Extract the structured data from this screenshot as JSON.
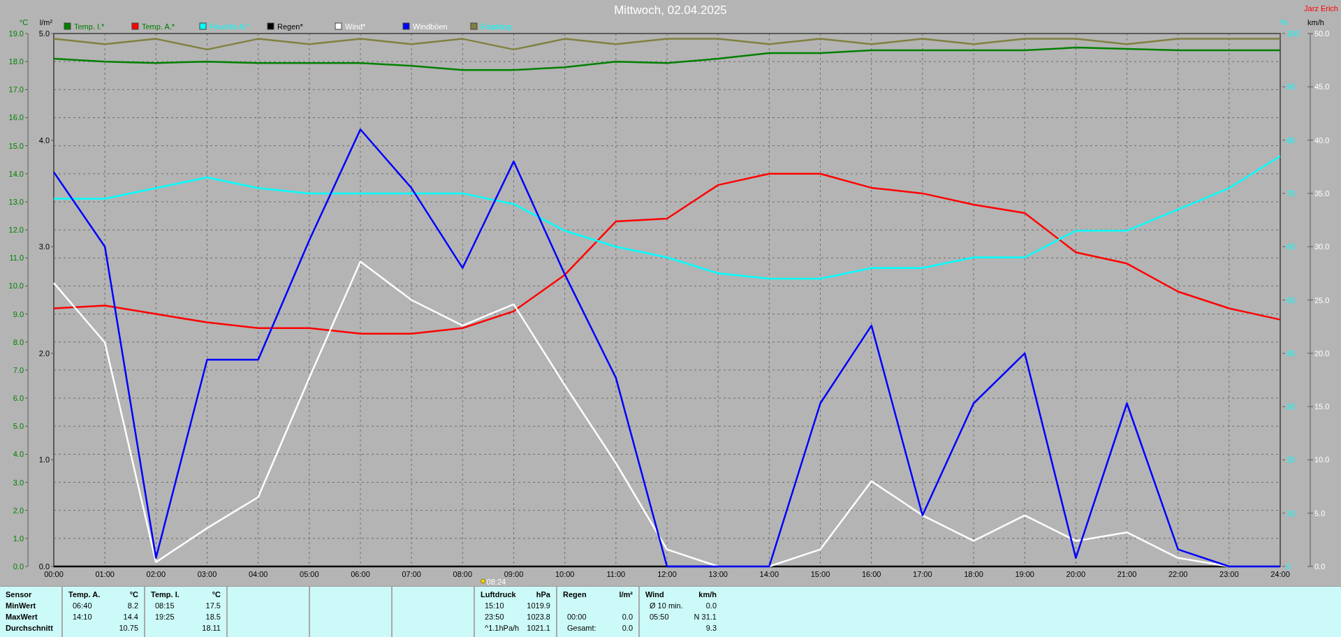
{
  "title": "Mittwoch, 02.04.2025",
  "author": "Jarz Erich",
  "chart": {
    "chart_data": {
      "type": "line",
      "categories": [
        "00:00",
        "01:00",
        "02:00",
        "03:00",
        "04:00",
        "05:00",
        "06:00",
        "07:00",
        "08:00",
        "09:00",
        "10:00",
        "11:00",
        "12:00",
        "13:00",
        "14:00",
        "15:00",
        "16:00",
        "17:00",
        "18:00",
        "19:00",
        "20:00",
        "21:00",
        "22:00",
        "23:00",
        "24:00"
      ],
      "grid": true,
      "legend": "top",
      "ylim": [
        0,
        19
      ],
      "y2lim": [
        0,
        100
      ],
      "y3lim": [
        0,
        50
      ],
      "y2ticks": [
        {
          "value": 0,
          "label": "0"
        },
        {
          "value": 10,
          "label": "10"
        },
        {
          "value": 20,
          "label": "20"
        },
        {
          "value": 30,
          "label": "30"
        },
        {
          "value": 40,
          "label": "40"
        },
        {
          "value": 50,
          "label": "50"
        },
        {
          "value": 60,
          "label": "60"
        },
        {
          "value": 70,
          "label": "70"
        },
        {
          "value": 80,
          "label": "80"
        },
        {
          "value": 90,
          "label": "90"
        },
        {
          "value": 100,
          "label": "100"
        }
      ],
      "y3ticks": [
        {
          "value": 0,
          "label": "0.0"
        },
        {
          "value": 5,
          "label": "5.0"
        },
        {
          "value": 10,
          "label": "10.0"
        },
        {
          "value": 15,
          "label": "15.0"
        },
        {
          "value": 20,
          "label": "20.0"
        },
        {
          "value": 25,
          "label": "25.0"
        },
        {
          "value": 30,
          "label": "30.0"
        },
        {
          "value": 35,
          "label": "35.0"
        },
        {
          "value": 40,
          "label": "40.0"
        },
        {
          "value": 45,
          "label": "45.0"
        },
        {
          "value": 50,
          "label": "50.0"
        }
      ],
      "yticks": [
        {
          "value": 0,
          "label": "0.0"
        },
        {
          "value": 1,
          "label": "1.0"
        },
        {
          "value": 2,
          "label": "2.0"
        },
        {
          "value": 3,
          "label": "3.0"
        },
        {
          "value": 4,
          "label": "4.0"
        },
        {
          "value": 5,
          "label": "5.0"
        },
        {
          "value": 6,
          "label": "6.0"
        },
        {
          "value": 7,
          "label": "7.0"
        },
        {
          "value": 8,
          "label": "8.0"
        },
        {
          "value": 9,
          "label": "9.0"
        },
        {
          "value": 10,
          "label": "10.0"
        },
        {
          "value": 11,
          "label": "11.0"
        },
        {
          "value": 12,
          "label": "12.0"
        },
        {
          "value": 13,
          "label": "13.0"
        },
        {
          "value": 14,
          "label": "14.0"
        },
        {
          "value": 15,
          "label": "15.0"
        },
        {
          "value": 16,
          "label": "16.0"
        },
        {
          "value": 17,
          "label": "17.0"
        },
        {
          "value": 18,
          "label": "18.0"
        },
        {
          "value": 19,
          "label": "19.0"
        }
      ],
      "series": [
        {
          "name": "Temp. I.*",
          "color": "#008000",
          "values": [
            18.1,
            18.0,
            17.95,
            18.0,
            17.95,
            17.95,
            17.95,
            17.85,
            17.7,
            17.7,
            17.8,
            18.0,
            17.95,
            18.1,
            18.3,
            18.3,
            18.4,
            18.4,
            18.4,
            18.4,
            18.5,
            18.45,
            18.4,
            18.4,
            18.4
          ]
        },
        {
          "name": "Temp. A.*",
          "color": "#ff0000",
          "values": [
            9.2,
            9.3,
            9.0,
            8.7,
            8.5,
            8.5,
            8.3,
            8.3,
            8.5,
            9.1,
            10.4,
            12.3,
            12.4,
            13.6,
            14.0,
            14.0,
            13.5,
            13.3,
            12.9,
            12.6,
            11.2,
            10.8,
            9.8,
            9.2,
            8.8
          ]
        },
        {
          "name": "Feuchte A.*",
          "color": "#00ffff",
          "axis": "y2",
          "values": [
            69,
            69,
            71,
            73,
            71,
            70,
            70,
            70,
            70,
            68,
            63,
            60,
            58,
            55,
            54,
            54,
            56,
            56,
            58,
            58,
            63,
            63,
            67,
            71,
            77
          ]
        },
        {
          "name": "Regen*",
          "color": "#000000",
          "values": [
            0,
            0,
            0,
            0,
            0,
            0,
            0,
            0,
            0,
            0,
            0,
            0,
            0,
            0,
            0,
            0,
            0,
            0,
            0,
            0,
            0,
            0,
            0,
            0,
            0
          ]
        },
        {
          "name": "Wind*",
          "color": "#ffffff",
          "axis": "y3",
          "values": [
            26.6,
            21,
            0.4,
            3.6,
            6.5,
            17.7,
            28.6,
            25,
            22.6,
            24.6,
            17,
            9.7,
            1.6,
            0,
            0,
            1.6,
            8,
            4.8,
            2.4,
            4.8,
            2.4,
            3.2,
            0.8,
            0,
            0
          ]
        },
        {
          "name": "Windböen",
          "color": "#0000ff",
          "axis": "y3",
          "values": [
            37,
            30,
            0.8,
            19.4,
            19.4,
            30.6,
            41,
            35.5,
            28,
            38,
            27.4,
            17.7,
            0,
            0,
            0,
            15.3,
            22.6,
            4.8,
            15.3,
            20,
            0.8,
            15.3,
            1.6,
            0,
            0
          ]
        },
        {
          "name": "Empfang",
          "color": "#808040",
          "axis": "y2",
          "values": [
            99,
            98,
            99,
            97,
            99,
            98,
            99,
            98,
            99,
            97,
            99,
            98,
            99,
            99,
            98,
            99,
            98,
            99,
            98,
            99,
            99,
            98,
            99,
            99,
            99
          ]
        }
      ]
    },
    "axis_units": [
      {
        "kind": "left-outer",
        "unit": "°C"
      },
      {
        "kind": "left-inner",
        "unit": "l/m²"
      },
      {
        "kind": "right-inner",
        "unit": "%"
      },
      {
        "kind": "right-outer",
        "unit": "km/h"
      }
    ],
    "rain_axis": {
      "ticks": [
        "5.0",
        "4.0",
        "3.0",
        "2.0",
        "1.0",
        "0.0"
      ]
    },
    "sun_marker": {
      "label": "08:24"
    }
  },
  "stats": {
    "row_labels": [
      "Sensor",
      "MinWert",
      "MaxWert",
      "Durchschnitt"
    ],
    "groups": [
      {
        "kind": "data",
        "title": "Temp. A.",
        "unit": "°C",
        "rows": [
          {
            "time": "06:40",
            "value": "8.2"
          },
          {
            "time": "14:10",
            "value": "14.4"
          },
          {
            "value": "10.75"
          }
        ]
      },
      {
        "kind": "data",
        "title": "Temp. I.",
        "unit": "°C",
        "rows": [
          {
            "time": "08:15",
            "value": "17.5"
          },
          {
            "time": "19:25",
            "value": "18.5"
          },
          {
            "value": "18.11"
          }
        ]
      },
      {
        "kind": "empty"
      },
      {
        "kind": "empty"
      },
      {
        "kind": "empty"
      },
      {
        "kind": "data",
        "title": "Luftdruck",
        "unit": "hPa",
        "rows": [
          {
            "time": "15:10",
            "value": "1019.9"
          },
          {
            "time": "23:50",
            "value": "1023.8"
          },
          {
            "time": "^1.1hPa/h",
            "value": "1021.1"
          }
        ]
      },
      {
        "kind": "data",
        "title": "Regen",
        "unit": "l/m²",
        "rows": [
          {},
          {
            "time": "00:00",
            "value": "0.0"
          },
          {
            "time": "Gesamt:",
            "value": "0.0"
          }
        ]
      },
      {
        "kind": "data",
        "title": "Wind",
        "unit": "km/h",
        "rows": [
          {
            "time": "Ø 10 min.",
            "value": "0.0"
          },
          {
            "time": "05:50",
            "value": "N 31.1"
          },
          {
            "value": "9.3"
          }
        ]
      }
    ]
  }
}
